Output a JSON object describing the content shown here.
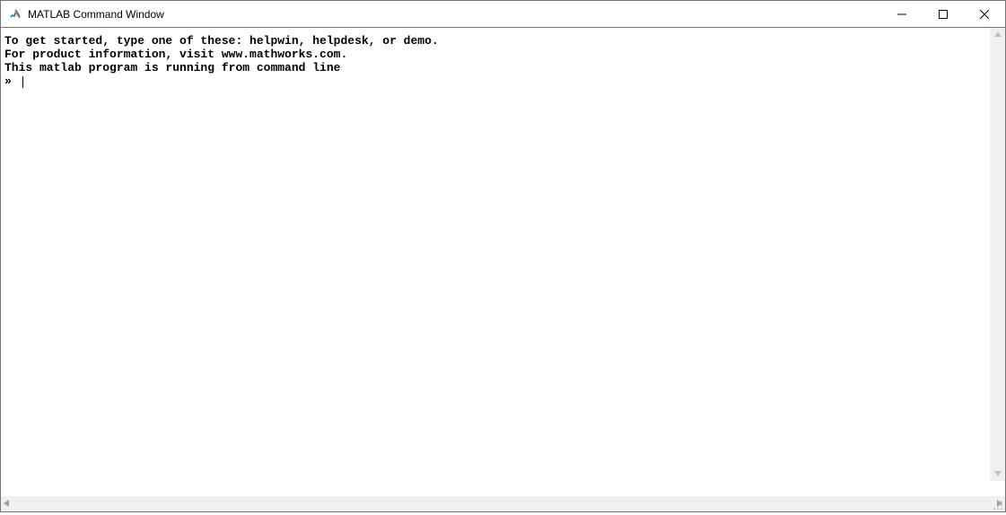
{
  "window": {
    "title": "MATLAB Command Window"
  },
  "terminal": {
    "line1": "To get started, type one of these: helpwin, helpdesk, or demo.",
    "line2": "For product information, visit www.mathworks.com.",
    "line3": "",
    "line4": "This matlab program is running from command line",
    "prompt": "» "
  }
}
